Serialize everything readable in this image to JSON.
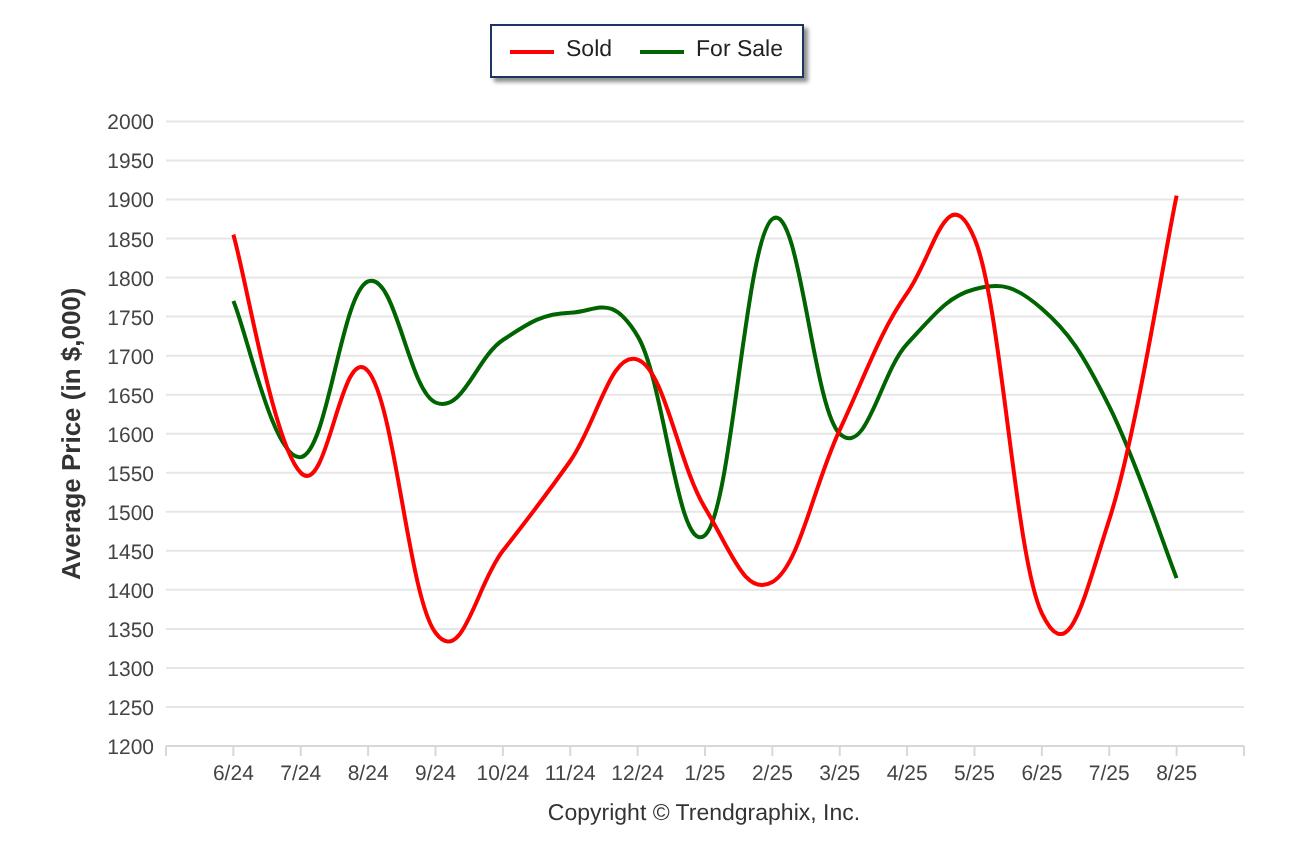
{
  "chart_data": {
    "type": "line",
    "ylabel": "Average Price (in $,000)",
    "categories": [
      "6/24",
      "7/24",
      "8/24",
      "9/24",
      "10/24",
      "11/24",
      "12/24",
      "1/25",
      "2/25",
      "3/25",
      "4/25",
      "5/25",
      "6/25",
      "7/25",
      "8/25"
    ],
    "series": [
      {
        "name": "Sold",
        "color": "#ff0000",
        "values": [
          1855,
          1550,
          1680,
          1345,
          1450,
          1565,
          1695,
          1505,
          1410,
          1605,
          1780,
          1850,
          1370,
          1490,
          1905
        ]
      },
      {
        "name": "For Sale",
        "color": "#006400",
        "values": [
          1770,
          1570,
          1795,
          1640,
          1720,
          1755,
          1725,
          1470,
          1875,
          1600,
          1715,
          1785,
          1760,
          1635,
          1415
        ]
      }
    ],
    "ylim": [
      1200,
      2000
    ],
    "grid": true,
    "yticks": [
      1200,
      1250,
      1300,
      1350,
      1400,
      1450,
      1500,
      1550,
      1600,
      1650,
      1700,
      1750,
      1800,
      1850,
      1900,
      1950,
      2000
    ]
  },
  "copyright": "Copyright © Trendgraphix, Inc."
}
